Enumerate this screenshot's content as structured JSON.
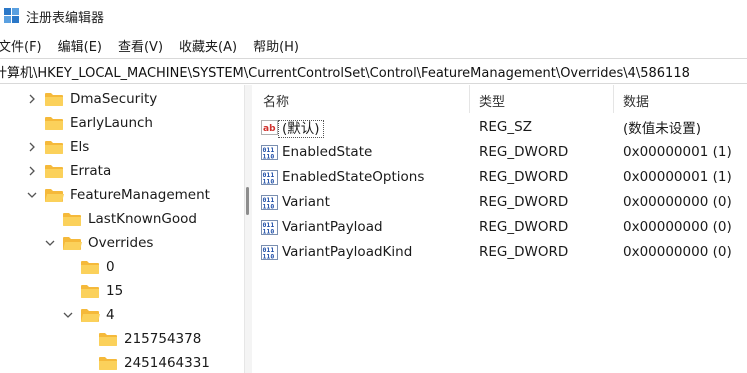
{
  "window": {
    "title": "注册表编辑器"
  },
  "menu": [
    "文件(F)",
    "编辑(E)",
    "查看(V)",
    "收藏夹(A)",
    "帮助(H)"
  ],
  "address": "计算机\\HKEY_LOCAL_MACHINE\\SYSTEM\\CurrentControlSet\\Control\\FeatureManagement\\Overrides\\4\\586118",
  "tree": [
    {
      "label": "DmaSecurity",
      "chevron": "right"
    },
    {
      "label": "EarlyLaunch",
      "chevron": "none"
    },
    {
      "label": "Els",
      "chevron": "right"
    },
    {
      "label": "Errata",
      "chevron": "right"
    },
    {
      "label": "FeatureManagement",
      "chevron": "down"
    },
    {
      "label": "LastKnownGood",
      "chevron": "none"
    },
    {
      "label": "Overrides",
      "chevron": "down"
    },
    {
      "label": "0",
      "chevron": "none"
    },
    {
      "label": "15",
      "chevron": "none"
    },
    {
      "label": "4",
      "chevron": "down"
    },
    {
      "label": "215754378",
      "chevron": "none"
    },
    {
      "label": "2451464331",
      "chevron": "none"
    }
  ],
  "columns": {
    "name": "名称",
    "type": "类型",
    "data": "数据"
  },
  "values": [
    {
      "name": "(默认)",
      "type": "REG_SZ",
      "data": "(数值未设置)",
      "icon": "string-value-icon"
    },
    {
      "name": "EnabledState",
      "type": "REG_DWORD",
      "data": "0x00000001 (1)",
      "icon": "binary-value-icon"
    },
    {
      "name": "EnabledStateOptions",
      "type": "REG_DWORD",
      "data": "0x00000001 (1)",
      "icon": "binary-value-icon"
    },
    {
      "name": "Variant",
      "type": "REG_DWORD",
      "data": "0x00000000 (0)",
      "icon": "binary-value-icon"
    },
    {
      "name": "VariantPayload",
      "type": "REG_DWORD",
      "data": "0x00000000 (0)",
      "icon": "binary-value-icon"
    },
    {
      "name": "VariantPayloadKind",
      "type": "REG_DWORD",
      "data": "0x00000000 (0)",
      "icon": "binary-value-icon"
    }
  ]
}
